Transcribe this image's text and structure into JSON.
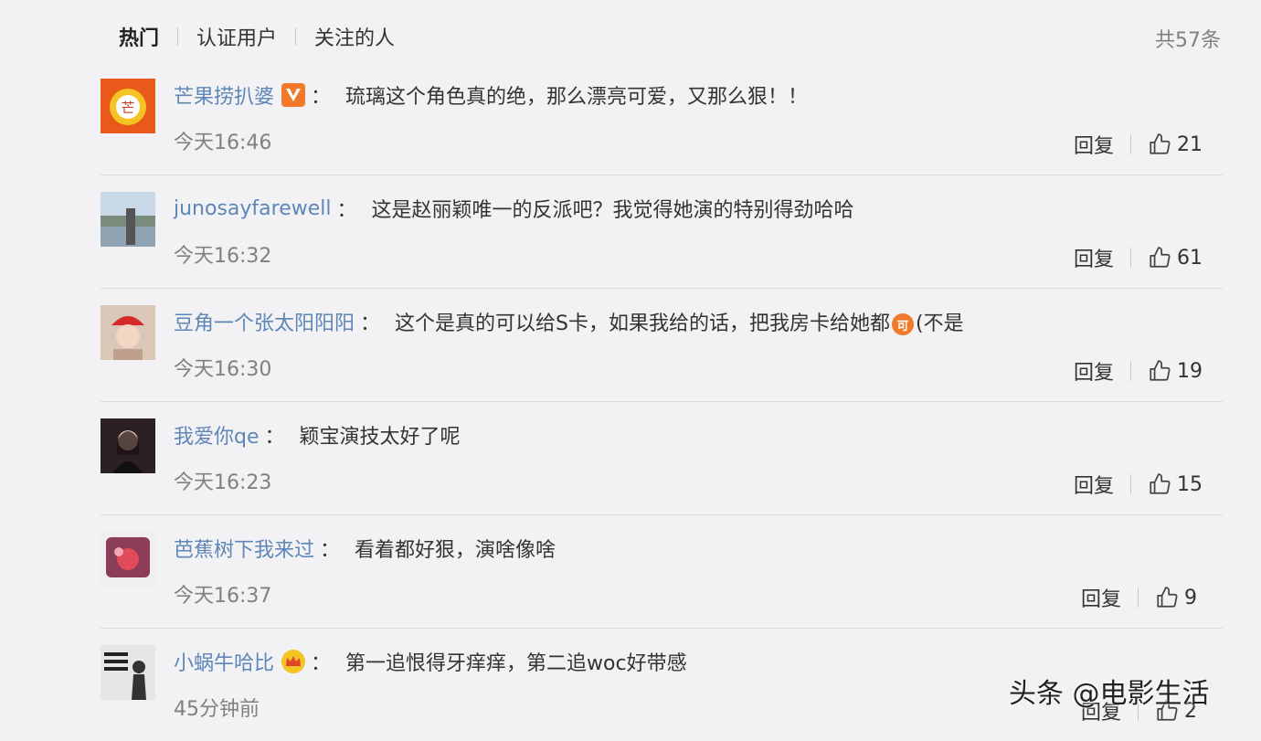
{
  "tabs": [
    "热门",
    "认证用户",
    "关注的人"
  ],
  "count": "共57条",
  "comments": [
    {
      "user": "芒果捞扒婆",
      "text": "琉璃这个角色真的绝，那么漂亮可爱，又那么狠！！",
      "time": "今天16:46",
      "reply": "回复",
      "likes": "21"
    },
    {
      "user": "junosayfarewell",
      "text": "这是赵丽颖唯一的反派吧？我觉得她演的特别得劲哈哈",
      "time": "今天16:32",
      "reply": "回复",
      "likes": "61"
    },
    {
      "user": "豆角一个张太阳阳阳",
      "text_a": "这个是真的可以给S卡，如果我给的话，把我房卡给她都",
      "emoji_char": "可",
      "text_b": "(不是",
      "time": "今天16:30",
      "reply": "回复",
      "likes": "19"
    },
    {
      "user": "我爱你qe",
      "text": "颖宝演技太好了呢",
      "time": "今天16:23",
      "reply": "回复",
      "likes": "15"
    },
    {
      "user": "芭蕉树下我来过",
      "text": "看着都好狠，演啥像啥",
      "time": "今天16:37",
      "reply": "回复",
      "likes": "9"
    },
    {
      "user": "小蜗牛哈比",
      "text": "第一追恨得牙痒痒，第二追woc好带感",
      "time": "45分钟前",
      "reply": "回复",
      "likes": "2"
    }
  ],
  "colon": "：",
  "watermark": "头条 @电影生活",
  "colors": {
    "username": "#5e86b8",
    "background": "#f2f2f5",
    "vip_badge": "#f07a2a"
  }
}
